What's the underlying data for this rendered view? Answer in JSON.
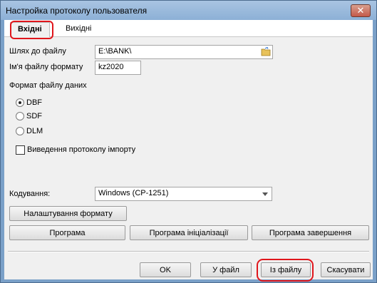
{
  "window": {
    "title": "Настройка протоколу пользователя",
    "close_glyph": "✕"
  },
  "tabs": [
    {
      "label": "Вхідні",
      "active": true
    },
    {
      "label": "Вихідні",
      "active": false
    }
  ],
  "form": {
    "path_label": "Шлях до файлу",
    "path_value": "E:\\BANK\\",
    "format_name_label": "Ім'я файлу формату",
    "format_name_value": "kz2020",
    "file_format_label": "Формат файлу даних",
    "formats": [
      {
        "label": "DBF",
        "selected": true
      },
      {
        "label": "SDF",
        "selected": false
      },
      {
        "label": "DLM",
        "selected": false
      }
    ],
    "import_log_label": "Виведення протоколу імпорту",
    "import_log_checked": false,
    "encoding_label": "Кодування:",
    "encoding_value": "Windows (CP-1251)"
  },
  "buttons": {
    "format_setup": "Налаштування формату",
    "program": "Програма",
    "program_init": "Програма ініціалізації",
    "program_finish": "Програма завершення",
    "ok": "OK",
    "to_file": "У файл",
    "from_file": "Із файлу",
    "cancel": "Скасувати"
  },
  "colors": {
    "highlight": "#e0161c",
    "titlebar": "#8cb0d6"
  },
  "icons": {
    "close": "close-icon",
    "folder": "folder-icon"
  }
}
